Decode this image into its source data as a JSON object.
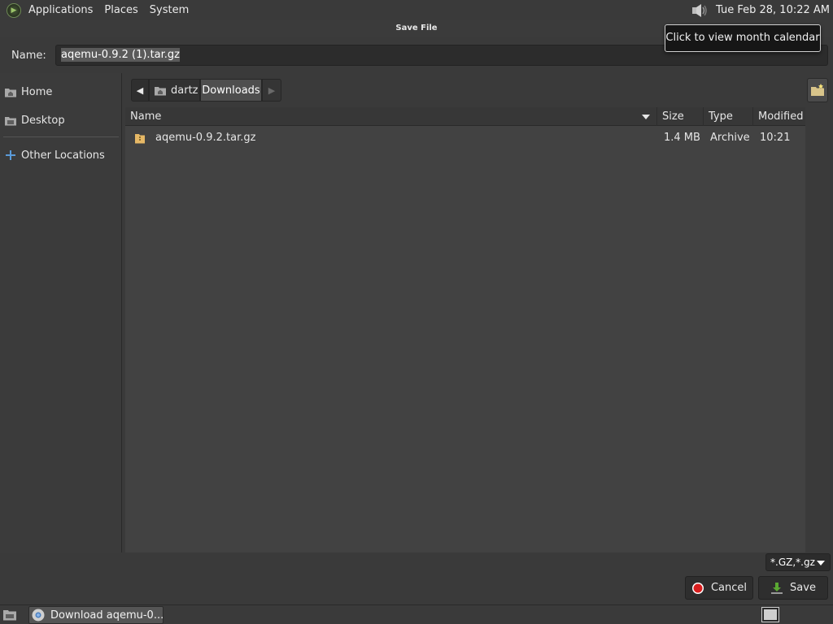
{
  "top_panel": {
    "menus": [
      "Applications",
      "Places",
      "System"
    ],
    "clock": "Tue Feb 28, 10:22 AM",
    "tooltip": "Click to view month calendar"
  },
  "dialog": {
    "title": "Save File",
    "name_label": "Name:",
    "name_value": "aqemu-0.9.2 (1).tar.gz"
  },
  "sidebar": {
    "items": [
      {
        "label": "Home",
        "icon": "home-folder-icon"
      },
      {
        "label": "Desktop",
        "icon": "desktop-folder-icon"
      },
      {
        "label": "Other Locations",
        "icon": "plus-icon"
      }
    ]
  },
  "pathbar": {
    "segments": [
      "dartz",
      "Downloads"
    ],
    "active": "Downloads"
  },
  "filelist": {
    "columns": {
      "name": "Name",
      "size": "Size",
      "type": "Type",
      "modified": "Modified"
    },
    "rows": [
      {
        "name": "aqemu-0.9.2.tar.gz",
        "size": "1.4 MB",
        "type": "Archive",
        "modified": "10:21",
        "icon": "archive-icon"
      }
    ]
  },
  "footer": {
    "filter": "*.GZ,*.gz",
    "cancel_label": "Cancel",
    "save_label": "Save"
  },
  "taskbar": {
    "task_label": "Download aqemu-0..."
  },
  "colors": {
    "panel_bg": "#3a3a3a",
    "list_bg": "#424242",
    "selected_path": "#4e4e4e",
    "cancel_red": "#d81e1e",
    "save_green": "#5aa832",
    "folder_tan": "#e6b866"
  }
}
